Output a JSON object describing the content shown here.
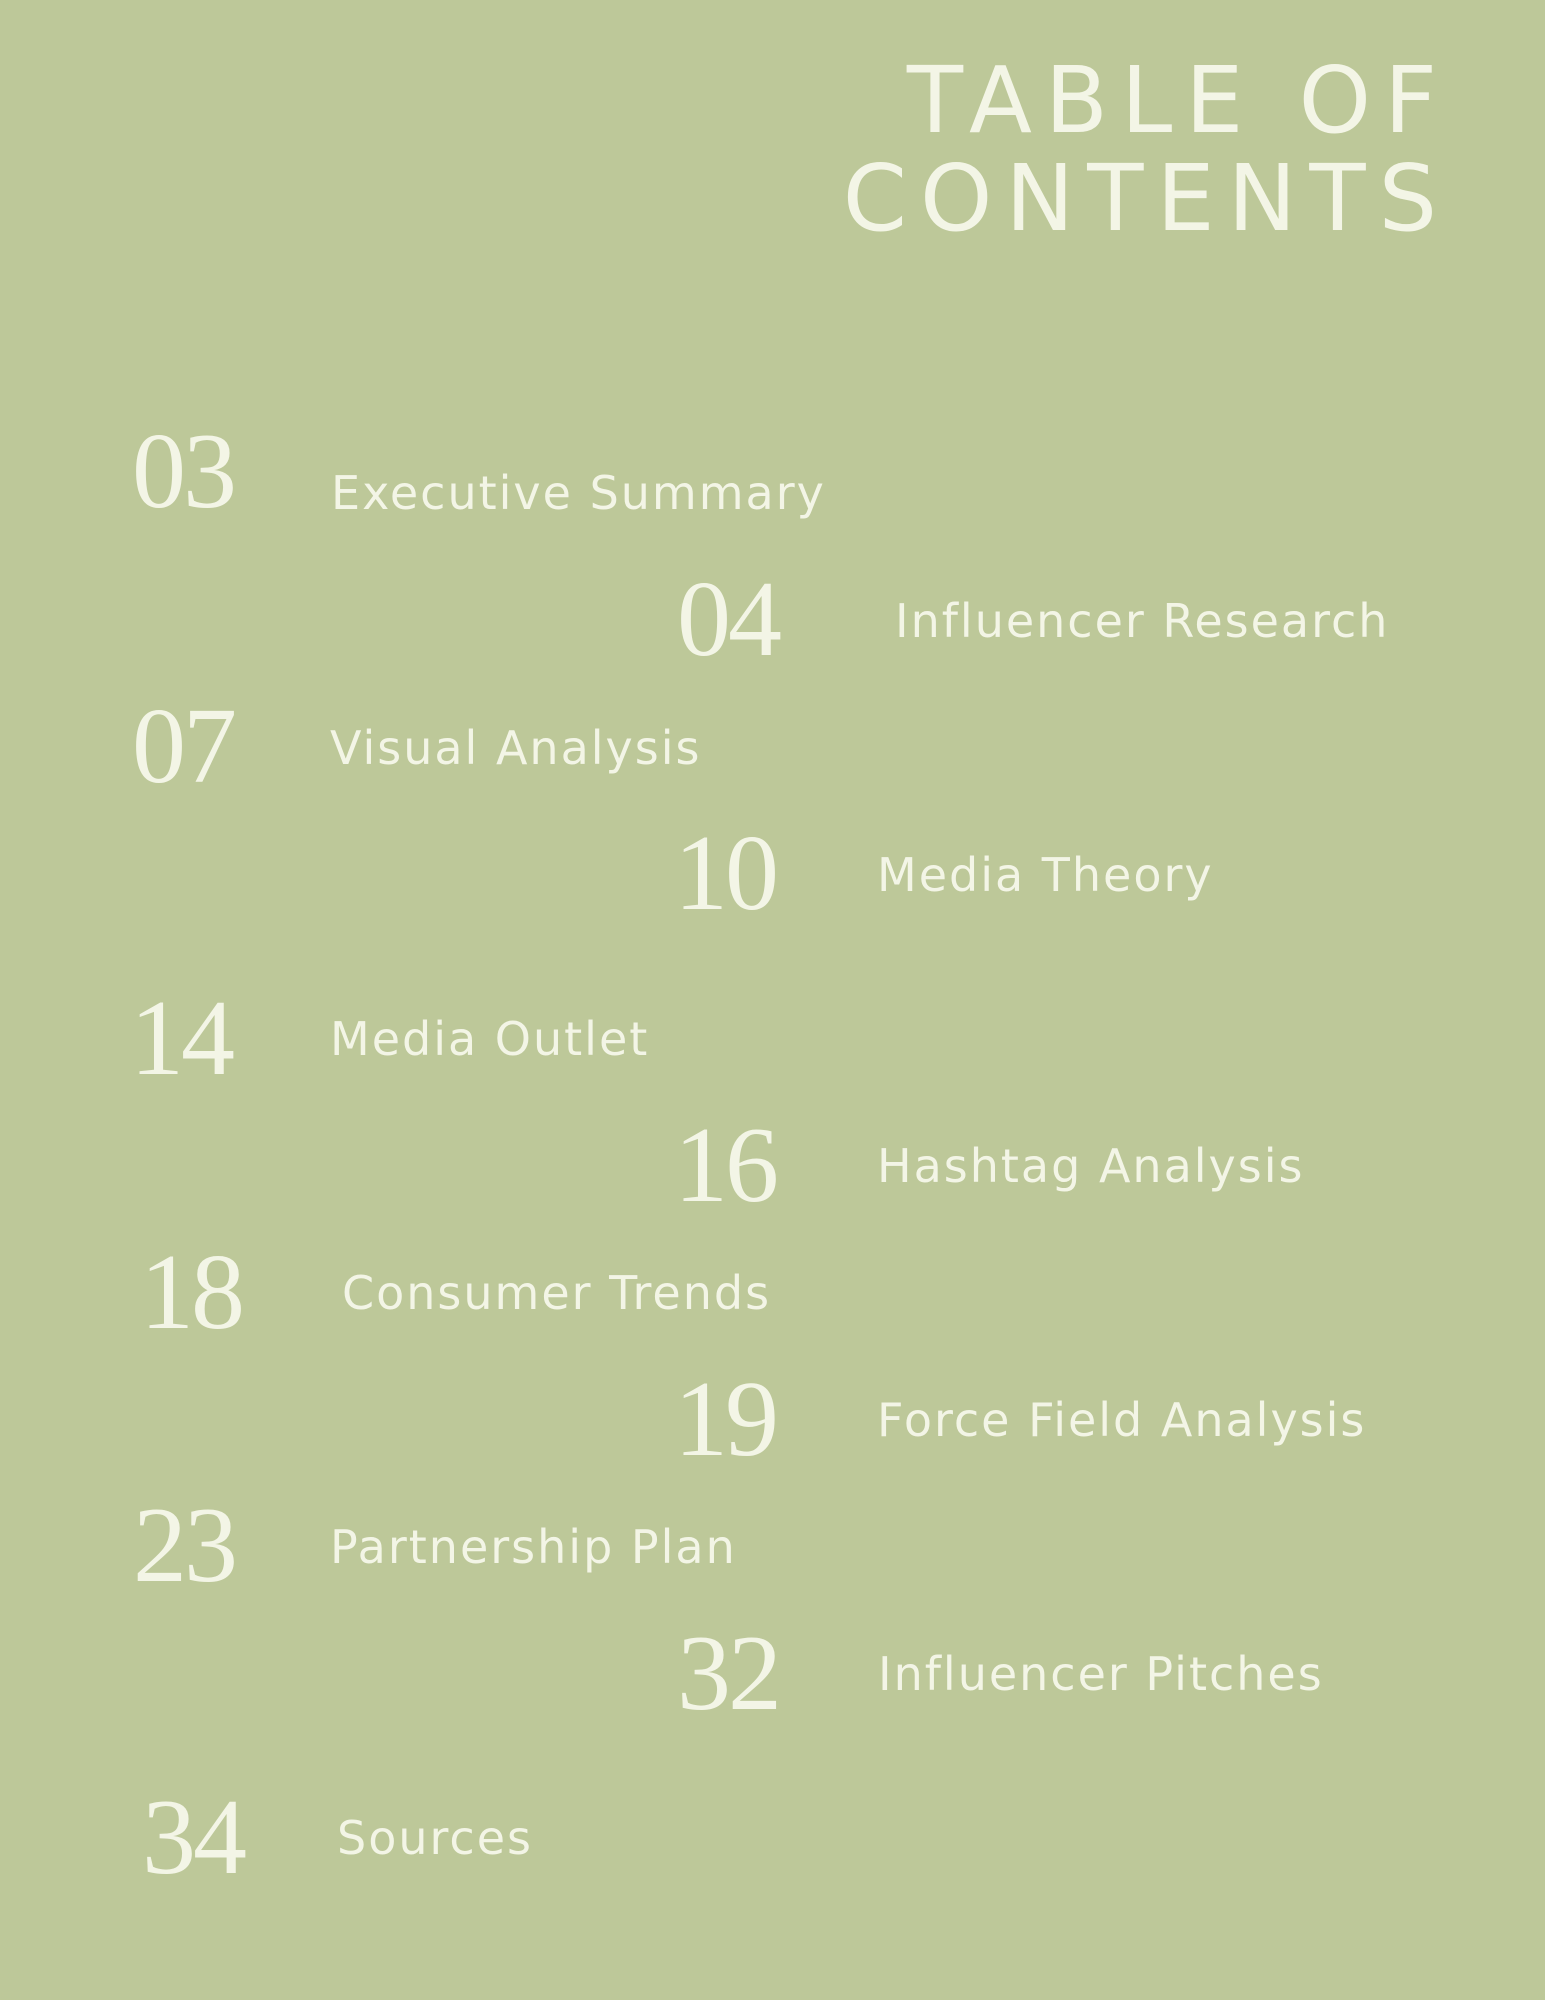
{
  "page": {
    "title_line1": "TABLE OF",
    "title_line2": "CONTENTS",
    "background_color": "#bdc899",
    "text_color": "#f3f5e6"
  },
  "toc": [
    {
      "page": "03",
      "label": "Executive Summary"
    },
    {
      "page": "04",
      "label": "Influencer Research"
    },
    {
      "page": "07",
      "label": "Visual Analysis"
    },
    {
      "page": "10",
      "label": "Media Theory"
    },
    {
      "page": "14",
      "label": "Media Outlet"
    },
    {
      "page": "16",
      "label": "Hashtag Analysis"
    },
    {
      "page": "18",
      "label": "Consumer Trends"
    },
    {
      "page": "19",
      "label": "Force Field Analysis"
    },
    {
      "page": "23",
      "label": "Partnership Plan"
    },
    {
      "page": "32",
      "label": "Influencer Pitches"
    },
    {
      "page": "34",
      "label": "Sources"
    }
  ]
}
